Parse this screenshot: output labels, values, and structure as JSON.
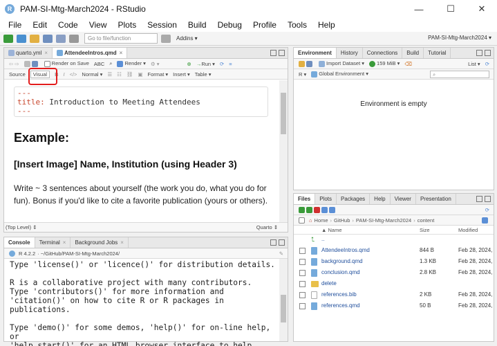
{
  "window": {
    "title": "PAM-SI-Mtg-March2024 - RStudio",
    "app_icon": "R",
    "minimize": "—",
    "maximize": "☐",
    "close": "✕"
  },
  "menu": [
    "File",
    "Edit",
    "Code",
    "View",
    "Plots",
    "Session",
    "Build",
    "Debug",
    "Profile",
    "Tools",
    "Help"
  ],
  "toolbar": {
    "goto_placeholder": "Go to file/function",
    "addins": "Addins ▾",
    "project": "PAM-SI-Mtg-March2024 ▾"
  },
  "editor": {
    "tabs": [
      {
        "label": "quarto.yml"
      },
      {
        "label": "AttendeeIntros.qmd"
      }
    ],
    "render_on_save": "Render on Save",
    "render": "Render ▾",
    "run": "Run ▾",
    "source": "Source",
    "visual": "Visual",
    "format_bar": {
      "bold": "B",
      "italic": "I",
      "code": "</>",
      "normal": "Normal ▾",
      "format": "Format ▾",
      "insert": "Insert ▾",
      "table": "Table ▾"
    },
    "yaml_open": "---",
    "yaml_key": "title:",
    "yaml_value": "Introduction to Meeting Attendees",
    "yaml_close": "---",
    "heading1": "Example:",
    "heading3": "[Insert Image] Name, Institution (using Header 3)",
    "paragraph": "Write ~ 3 sentences about yourself (the work you do, what you do for fun). Bonus if you'd like to cite a favorite publication (yours or others).",
    "status_left": "(Top Level) ⇕",
    "status_right": "Quarto ⇕"
  },
  "console": {
    "tabs": [
      {
        "label": "Console"
      },
      {
        "label": "Terminal"
      },
      {
        "label": "Background Jobs"
      }
    ],
    "version": "R 4.2.2",
    "path": "· ~/GitHub/PAM-SI-Mtg-March2024/",
    "text": "Type 'license()' or 'licence()' for distribution details.\n\nR is a collaborative project with many contributors.\nType 'contributors()' for more information and\n'citation()' on how to cite R or R packages in publications.\n\nType 'demo()' for some demos, 'help()' for on-line help, or\n'help.start()' for an HTML browser interface to help."
  },
  "environment": {
    "tabs": [
      {
        "label": "Environment"
      },
      {
        "label": "History"
      },
      {
        "label": "Connections"
      },
      {
        "label": "Build"
      },
      {
        "label": "Tutorial"
      }
    ],
    "import_dataset": "Import Dataset ▾",
    "memory": "159 MiB ▾",
    "list": "List ▾",
    "r_dropdown": "R ▾",
    "scope": "Global Environment ▾",
    "empty_message": "Environment is empty"
  },
  "files": {
    "tabs": [
      {
        "label": "Files"
      },
      {
        "label": "Plots"
      },
      {
        "label": "Packages"
      },
      {
        "label": "Help"
      },
      {
        "label": "Viewer"
      },
      {
        "label": "Presentation"
      }
    ],
    "breadcrumb": [
      "Home",
      "GitHub",
      "PAM-SI-Mtg-March2024",
      "content"
    ],
    "columns": {
      "name": "▲ Name",
      "size": "Size",
      "modified": "Modified"
    },
    "parent": "..",
    "rows": [
      {
        "name": "AttendeeIntros.qmd",
        "size": "844 B",
        "modified": "Feb 28, 2024,",
        "icon": "qmd-icon"
      },
      {
        "name": "background.qmd",
        "size": "1.3 KB",
        "modified": "Feb 28, 2024,",
        "icon": "qmd-icon"
      },
      {
        "name": "conclusion.qmd",
        "size": "2.8 KB",
        "modified": "Feb 28, 2024,",
        "icon": "qmd-icon"
      },
      {
        "name": "delete",
        "size": "",
        "modified": "",
        "icon": "folder-icon"
      },
      {
        "name": "references.bib",
        "size": "2 KB",
        "modified": "Feb 28, 2024,",
        "icon": "file-icon"
      },
      {
        "name": "references.qmd",
        "size": "50 B",
        "modified": "Feb 28, 2024,",
        "icon": "qmd-icon"
      }
    ]
  },
  "colors": {
    "accent": "#75aadb",
    "highlight": "#e31c1c",
    "link": "#1f4e9c",
    "yaml": "#c8462c"
  }
}
